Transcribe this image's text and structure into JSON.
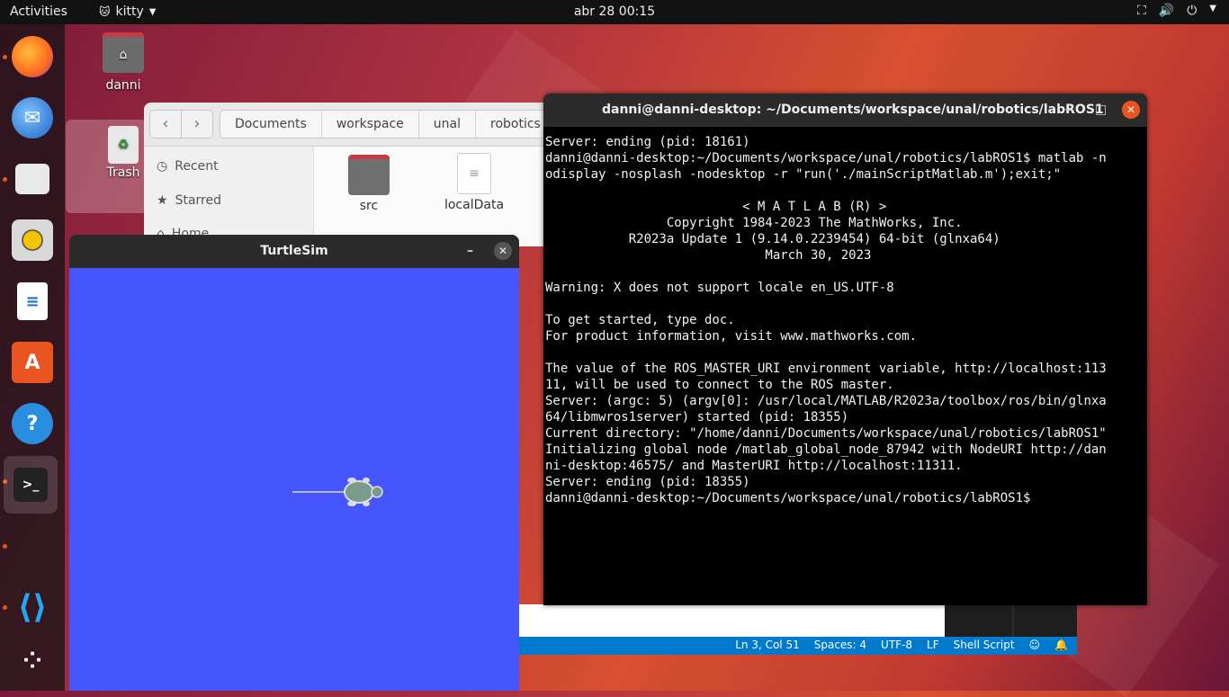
{
  "topbar": {
    "activities": "Activities",
    "app_name": "kitty",
    "clock": "abr 28  00:15"
  },
  "dock": {
    "items": [
      "firefox-icon",
      "thunderbird-icon",
      "files-icon",
      "rhythmbox-icon",
      "writer-icon",
      "software-icon",
      "help-icon",
      "kitty-icon",
      "vscode-icon",
      "app-grid-icon"
    ]
  },
  "desktop": {
    "home_label": "danni",
    "trash_label": "Trash"
  },
  "files": {
    "breadcrumbs": [
      "Documents",
      "workspace",
      "unal",
      "robotics"
    ],
    "sidebar": [
      "Recent",
      "Starred",
      "Home"
    ],
    "items": [
      "src",
      "localData"
    ]
  },
  "turtlesim": {
    "title": "TurtleSim",
    "bg_color": "#4556ff"
  },
  "terminal": {
    "title": "danni@danni-desktop: ~/Documents/workspace/unal/robotics/labROS1",
    "lines": [
      "Server: ending (pid: 18161)",
      "danni@danni-desktop:~/Documents/workspace/unal/robotics/labROS1$ matlab -n",
      "odisplay -nosplash -nodesktop -r \"run('./mainScriptMatlab.m');exit;\"",
      "",
      "                          < M A T L A B (R) >",
      "                Copyright 1984-2023 The MathWorks, Inc.",
      "           R2023a Update 1 (9.14.0.2239454) 64-bit (glnxa64)",
      "                             March 30, 2023",
      "",
      "Warning: X does not support locale en_US.UTF-8",
      "",
      "To get started, type doc.",
      "For product information, visit www.mathworks.com.",
      "",
      "The value of the ROS_MASTER_URI environment variable, http://localhost:113",
      "11, will be used to connect to the ROS master.",
      "Server: (argc: 5) (argv[0]: /usr/local/MATLAB/R2023a/toolbox/ros/bin/glnxa",
      "64/libmwros1server) started (pid: 18355)",
      "Current directory: \"/home/danni/Documents/workspace/unal/robotics/labROS1\"",
      "Initializing global node /matlab_global_node_87942 with NodeURI http://dan",
      "ni-desktop:46575/ and MasterURI http://localhost:11311.",
      "Server: ending (pid: 18355)",
      "danni@danni-desktop:~/Documents/workspace/unal/robotics/labROS1$"
    ]
  },
  "vscode_status": {
    "position": "Ln 3, Col 51",
    "spaces": "Spaces: 4",
    "encoding": "UTF-8",
    "eol": "LF",
    "language": "Shell Script"
  }
}
